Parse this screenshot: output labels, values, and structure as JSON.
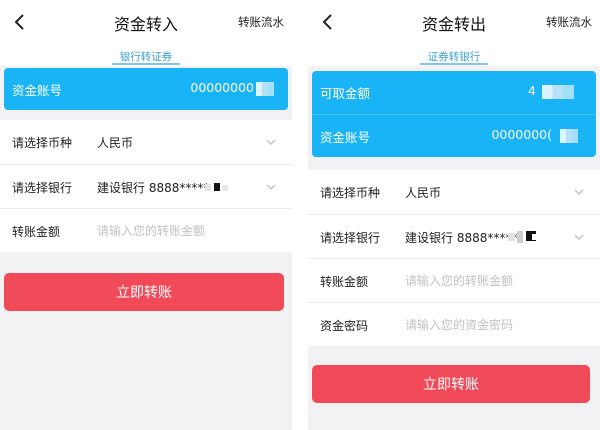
{
  "left": {
    "title": "资金转入",
    "nav_link": "转账流水",
    "subtitle": "银行转证券",
    "card": {
      "account_label": "资金账号",
      "account_value": "00000000"
    },
    "form": {
      "currency_label": "请选择币种",
      "currency_value": "人民币",
      "bank_label": "请选择银行",
      "bank_value": "建设银行 8888*****",
      "amount_label": "转账金额",
      "amount_placeholder": "请输入您的转账金额"
    },
    "submit_label": "立即转账"
  },
  "right": {
    "title": "资金转出",
    "nav_link": "转账流水",
    "subtitle": "证券转银行",
    "card": {
      "withdrawable_label": "可取金额",
      "withdrawable_value": "4",
      "account_label": "资金账号",
      "account_value": "0000000("
    },
    "form": {
      "currency_label": "请选择币种",
      "currency_value": "人民币",
      "bank_label": "请选择银行",
      "bank_value": "建设银行 8888*****",
      "amount_label": "转账金额",
      "amount_placeholder": "请输入您的转账金额",
      "password_label": "资金密码",
      "password_placeholder": "请输入您的资金密码"
    },
    "submit_label": "立即转账"
  },
  "colors": {
    "card_blue": "#19b4f5",
    "submit_red": "#f04a59",
    "subtitle_blue": "#3c9fd6"
  },
  "icons": {
    "back": "back-arrow-icon",
    "chevron": "chevron-down-icon"
  }
}
